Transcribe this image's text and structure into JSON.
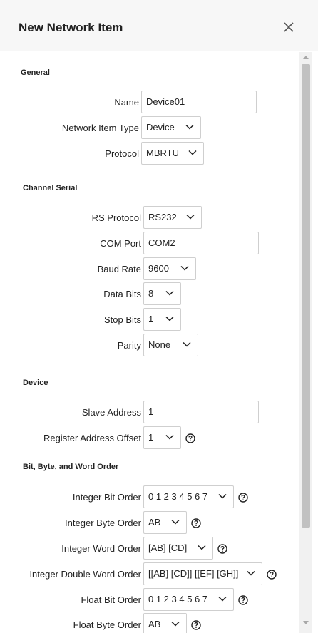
{
  "dialog": {
    "title": "New Network Item",
    "close_icon": "close-icon"
  },
  "sections": {
    "general": "General",
    "channel_serial": "Channel Serial",
    "device": "Device",
    "order": "Bit, Byte, and Word Order"
  },
  "fields": {
    "name": {
      "label": "Name",
      "value": "Device01"
    },
    "network_item_type": {
      "label": "Network Item Type",
      "value": "Device"
    },
    "protocol": {
      "label": "Protocol",
      "value": "MBRTU"
    },
    "rs_protocol": {
      "label": "RS Protocol",
      "value": "RS232"
    },
    "com_port": {
      "label": "COM Port",
      "value": "COM2"
    },
    "baud_rate": {
      "label": "Baud Rate",
      "value": "9600"
    },
    "data_bits": {
      "label": "Data Bits",
      "value": "8"
    },
    "stop_bits": {
      "label": "Stop Bits",
      "value": "1"
    },
    "parity": {
      "label": "Parity",
      "value": "None"
    },
    "slave_address": {
      "label": "Slave Address",
      "value": "1"
    },
    "register_address_offset": {
      "label": "Register Address Offset",
      "value": "1"
    },
    "integer_bit_order": {
      "label": "Integer Bit Order",
      "value": "0 1 2 3 4 5 6 7"
    },
    "integer_byte_order": {
      "label": "Integer Byte Order",
      "value": "AB"
    },
    "integer_word_order": {
      "label": "Integer Word Order",
      "value": "[AB] [CD]"
    },
    "integer_double_word_order": {
      "label": "Integer Double Word Order",
      "value": "[[AB] [CD]] [[EF] [GH]]"
    },
    "float_bit_order": {
      "label": "Float Bit Order",
      "value": "0 1 2 3 4 5 6 7"
    },
    "float_byte_order": {
      "label": "Float Byte Order",
      "value": "AB"
    }
  },
  "icons": {
    "help": "question-circle-icon",
    "dropdown": "chevron-down-icon"
  }
}
